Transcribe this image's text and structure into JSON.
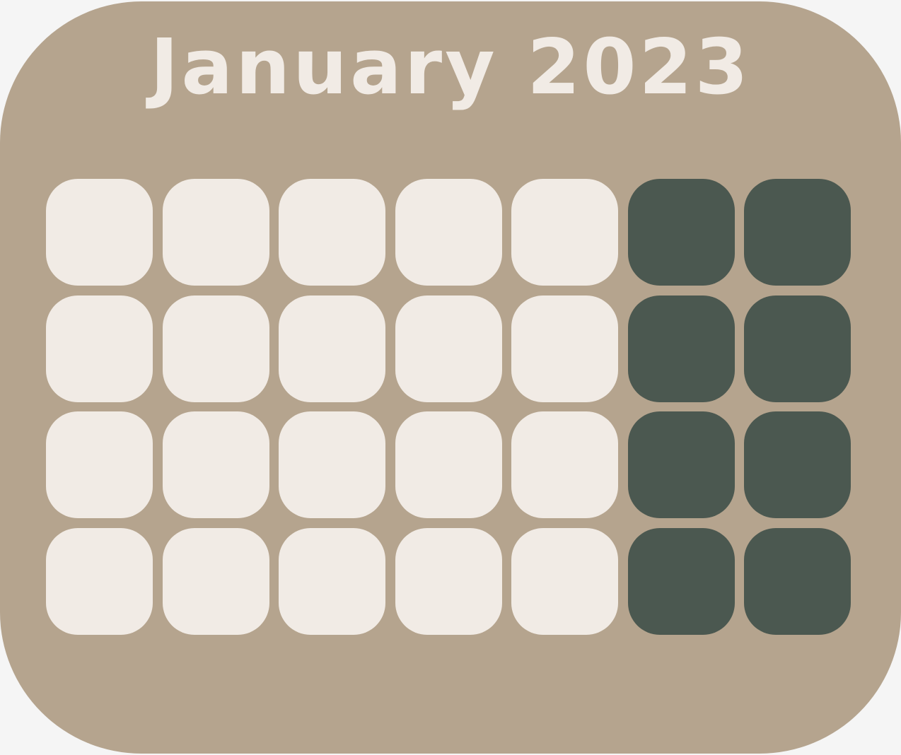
{
  "calendar": {
    "title": "January 2023",
    "colors": {
      "background": "#b5a48e",
      "title_text": "#f1ebe5",
      "weekday_cell": "#f1ebe5",
      "weekend_cell": "#4b5850"
    },
    "weeks": [
      [
        "weekday",
        "weekday",
        "weekday",
        "weekday",
        "weekday",
        "weekend",
        "weekend"
      ],
      [
        "weekday",
        "weekday",
        "weekday",
        "weekday",
        "weekday",
        "weekend",
        "weekend"
      ],
      [
        "weekday",
        "weekday",
        "weekday",
        "weekday",
        "weekday",
        "weekend",
        "weekend"
      ],
      [
        "weekday",
        "weekday",
        "weekday",
        "weekday",
        "weekday",
        "weekend",
        "weekend"
      ]
    ]
  }
}
